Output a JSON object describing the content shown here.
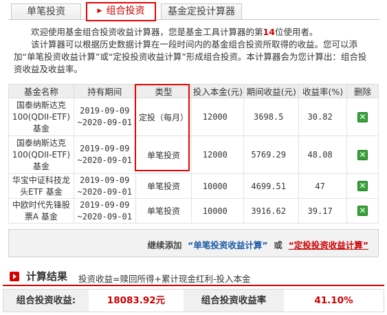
{
  "tabs": [
    {
      "label": "单笔投资"
    },
    {
      "label": "组合投资",
      "active": true
    },
    {
      "label": "基金定投计算器"
    }
  ],
  "intro": {
    "line1_prefix": "欢迎使用基金组合投资收益计算器，您是基金工具计算器的第",
    "user_count": "14",
    "line1_suffix": "位使用者。",
    "line2": "该计算器可以根据历史数据计算在一段时间内的基金组合投资所取得的收益。您可以添加“单笔投资收益计算”或“定投投资收益计算”形成组合投资。本计算器会为您计算出：组合投资收益及收益率。"
  },
  "table": {
    "headers": [
      "基金名称",
      "持有期间",
      "类型",
      "投入本金(元)",
      "期间收益(元)",
      "收益率(%)",
      "删除"
    ],
    "rows": [
      {
        "name": "国泰纳斯达克100(QDII-ETF)基金",
        "start": "2019-09-09",
        "end": "~2020-09-01",
        "type": "定投（每月）",
        "principal": "12000",
        "gain": "3698.5",
        "rate": "30.82"
      },
      {
        "name": "国泰纳斯达克100(QDII-ETF)基金",
        "start": "2019-09-09",
        "end": "~2020-09-01",
        "type": "单笔投资",
        "principal": "12000",
        "gain": "5769.29",
        "rate": "48.08"
      },
      {
        "name": "华宝中证科技龙头ETF 基金",
        "start": "2019-09-09",
        "end": "~2020-09-01",
        "type": "单笔投资",
        "principal": "10000",
        "gain": "4699.51",
        "rate": "47"
      },
      {
        "name": "中欧时代先锋股票A 基金",
        "start": "2019-09-09",
        "end": "~2020-09-01",
        "type": "单笔投资",
        "principal": "10000",
        "gain": "3916.62",
        "rate": "39.17"
      }
    ],
    "delete_glyph": "✕"
  },
  "addbar": {
    "prefix": "继续添加",
    "link1": "“单笔投资收益计算”",
    "or": "或",
    "link2": "“定投投资收益计算”"
  },
  "result": {
    "title": "计算结果",
    "formula": "投资收益=赎回所得+累计现金红利-投入本金",
    "label1": "组合投资收益:",
    "value1": "18083.92元",
    "label2": "组合投资收益率",
    "value2": "41.10%"
  },
  "colors": {
    "accent": "#e60000",
    "link": "#1a5aa6",
    "delete": "#37a23a"
  }
}
